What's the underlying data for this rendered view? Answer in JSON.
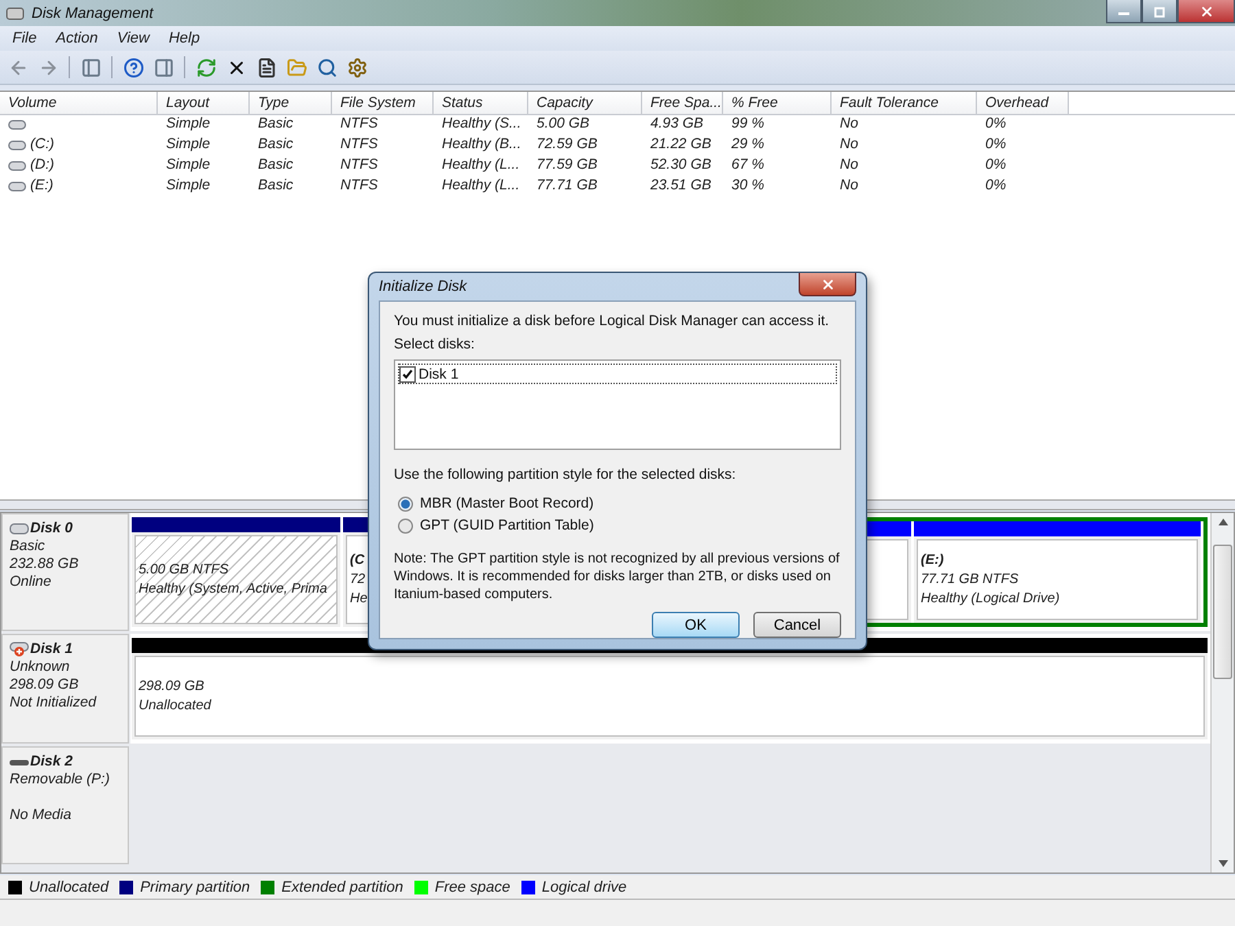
{
  "window": {
    "title": "Disk Management"
  },
  "menu": [
    "File",
    "Action",
    "View",
    "Help"
  ],
  "volumes": {
    "columns": [
      "Volume",
      "Layout",
      "Type",
      "File System",
      "Status",
      "Capacity",
      "Free Spa...",
      "% Free",
      "Fault Tolerance",
      "Overhead"
    ],
    "rows": [
      {
        "cells": [
          "",
          "Simple",
          "Basic",
          "NTFS",
          "Healthy (S...",
          "5.00 GB",
          "4.93 GB",
          "99 %",
          "No",
          "0%"
        ]
      },
      {
        "cells": [
          "(C:)",
          "Simple",
          "Basic",
          "NTFS",
          "Healthy (B...",
          "72.59 GB",
          "21.22 GB",
          "29 %",
          "No",
          "0%"
        ]
      },
      {
        "cells": [
          "(D:)",
          "Simple",
          "Basic",
          "NTFS",
          "Healthy (L...",
          "77.59 GB",
          "52.30 GB",
          "67 %",
          "No",
          "0%"
        ]
      },
      {
        "cells": [
          "(E:)",
          "Simple",
          "Basic",
          "NTFS",
          "Healthy (L...",
          "77.71 GB",
          "23.51 GB",
          "30 %",
          "No",
          "0%"
        ]
      }
    ]
  },
  "disks": [
    {
      "name": "Disk 0",
      "kind": "basic",
      "type": "Basic",
      "size": "232.88 GB",
      "status": "Online",
      "partitions": [
        {
          "kind": "primary",
          "selected": true,
          "size": "5.00 GB NTFS",
          "status": "Healthy (System, Active, Prima"
        },
        {
          "kind": "primary",
          "selected": false,
          "label": "(C",
          "size": "72",
          "status": "He"
        },
        {
          "kind": "extended",
          "children": [
            {
              "kind": "logical"
            },
            {
              "kind": "logical",
              "selected": false,
              "label": "(E:)",
              "size": "77.71 GB NTFS",
              "status": "Healthy (Logical Drive)"
            }
          ]
        }
      ]
    },
    {
      "name": "Disk 1",
      "kind": "uninitialized",
      "type": "Unknown",
      "size": "298.09 GB",
      "status": "Not Initialized",
      "partitions": [
        {
          "kind": "unallocated",
          "selected": false,
          "size": "298.09 GB",
          "status": "Unallocated"
        }
      ]
    },
    {
      "name": "Disk 2",
      "kind": "removable",
      "type": "Removable (P:)",
      "status": "No Media"
    }
  ],
  "legend": [
    {
      "label": "Unallocated",
      "color": "#000000"
    },
    {
      "label": "Primary partition",
      "color": "#000080"
    },
    {
      "label": "Extended partition",
      "color": "#008000"
    },
    {
      "label": "Free space",
      "color": "#00ff00"
    },
    {
      "label": "Logical drive",
      "color": "#0000ff"
    }
  ],
  "dialog": {
    "title": "Initialize Disk",
    "message": "You must initialize a disk before Logical Disk Manager can access it.",
    "list_label": "Select disks:",
    "disks": [
      {
        "label": "Disk 1",
        "checked": true
      }
    ],
    "style_label": "Use the following partition style for the selected disks:",
    "options": [
      {
        "label": "MBR (Master Boot Record)",
        "selected": true
      },
      {
        "label": "GPT (GUID Partition Table)",
        "selected": false
      }
    ],
    "note": "Note: The GPT partition style is not recognized by all previous versions of Windows. It is recommended for disks larger than 2TB, or disks used on Itanium-based computers.",
    "buttons": [
      {
        "label": "OK",
        "default": true
      },
      {
        "label": "Cancel",
        "default": false
      }
    ]
  }
}
